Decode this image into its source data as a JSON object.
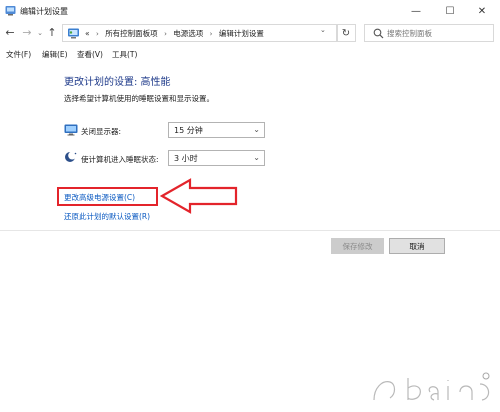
{
  "window": {
    "title": "编辑计划设置",
    "minimize_glyph": "—",
    "maximize_glyph": "☐",
    "close_glyph": "✕"
  },
  "nav": {
    "back_glyph": "←",
    "forward_glyph": "→",
    "dropdown_glyph": "⌄",
    "up_glyph": "↑",
    "overflow": "«",
    "breadcrumbs": [
      "所有控制面板项",
      "电源选项",
      "编辑计划设置"
    ],
    "crumb_separator": "›",
    "address_dropdown_glyph": "⌄",
    "refresh_glyph": "↻",
    "search_placeholder": "搜索控制面板"
  },
  "menu": {
    "items": [
      "文件(F)",
      "编辑(E)",
      "查看(V)",
      "工具(T)"
    ]
  },
  "content": {
    "heading": "更改计划的设置: 高性能",
    "subtext": "选择希望计算机使用的睡眠设置和显示设置。",
    "rows": [
      {
        "label": "关闭显示器:",
        "value": "15 分钟",
        "icon": "monitor-icon"
      },
      {
        "label": "使计算机进入睡眠状态:",
        "value": "3 小时",
        "icon": "moon-icon"
      }
    ],
    "select_arrow_glyph": "⌄",
    "advanced_link": "更改高级电源设置(C)",
    "restore_link": "还原此计划的默认设置(R)"
  },
  "buttons": {
    "save": "保存修改",
    "cancel": "取消"
  },
  "colors": {
    "heading": "#1e3a8a",
    "link": "#0b5ac2",
    "annotation": "#e3242b"
  }
}
